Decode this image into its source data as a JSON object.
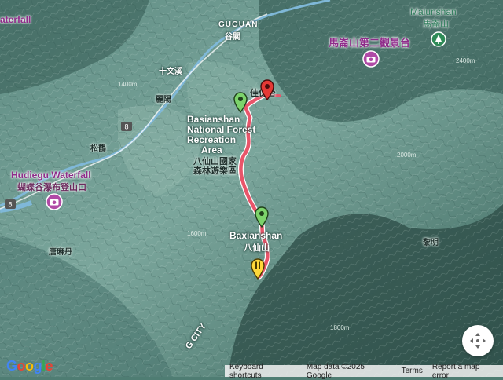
{
  "map": {
    "labels": {
      "guguan": "GUGUAN",
      "guguan_zh": "谷關",
      "malunshan": "Malunshan",
      "malunshan_zh": "馬崙山",
      "viewpoint": "馬崙山第二觀景台",
      "shiwenxi": "十文溪",
      "liyang": "麗陽",
      "songhe": "松鶴",
      "jiabao": "佳保台",
      "bas_en_1": "Basianshan",
      "bas_en_2": "National Forest",
      "bas_en_3": "Recreation",
      "bas_en_4": "Area",
      "bas_zh_1": "八仙山國家",
      "bas_zh_2": "森林遊樂區",
      "hudiegu_en": "Hudiegu Waterfall",
      "hudiegu_zh": "蝴蝶谷瀑布登山口",
      "baxianshan": "Baxianshan",
      "baxianshan_zh": "八仙山",
      "tangmadan": "唐麻丹",
      "liming": "黎明",
      "city": "G CITY",
      "waterfall_partial": "aterfall",
      "road_8a": "8",
      "road_8b": "8",
      "elev_2000": "2000m",
      "elev_1600": "1600m",
      "elev_2400": "2400m",
      "elev_1800": "1800m",
      "elev_1400": "1400m"
    },
    "colors": {
      "route": "#e8556a",
      "route_edge": "#ffffff",
      "start_pin": "#7cd36b",
      "end_pin": "#e53935",
      "waypoint_pin": "#ffd83a",
      "river": "#7fb8d8"
    },
    "icons": [
      "camera-icon",
      "park-icon",
      "location-pin-icon",
      "compass-control-icon"
    ],
    "controls": {
      "keyboard": "Keyboard shortcuts",
      "map_data": "Map data ©2025 Google",
      "terms": "Terms",
      "report": "Report a map error",
      "logo": "Google"
    }
  }
}
